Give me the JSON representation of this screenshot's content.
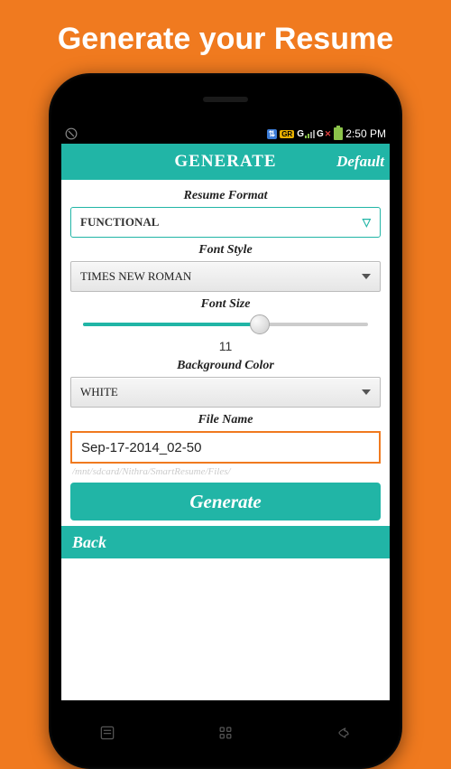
{
  "promo": {
    "title": "Generate your Resume"
  },
  "status": {
    "time": "2:50 PM"
  },
  "header": {
    "title": "GENERATE",
    "default_label": "Default"
  },
  "form": {
    "resume_format": {
      "label": "Resume Format",
      "value": "FUNCTIONAL"
    },
    "font_style": {
      "label": "Font Style",
      "value": "TIMES NEW ROMAN"
    },
    "font_size": {
      "label": "Font Size",
      "value": "11"
    },
    "bg_color": {
      "label": "Background Color",
      "value": "WHITE"
    },
    "file_name": {
      "label": "File Name",
      "value": "Sep-17-2014_02-50"
    },
    "file_path": "/mnt/sdcard/Nithra/SmartResume/Files/"
  },
  "actions": {
    "generate": "Generate",
    "back": "Back"
  }
}
